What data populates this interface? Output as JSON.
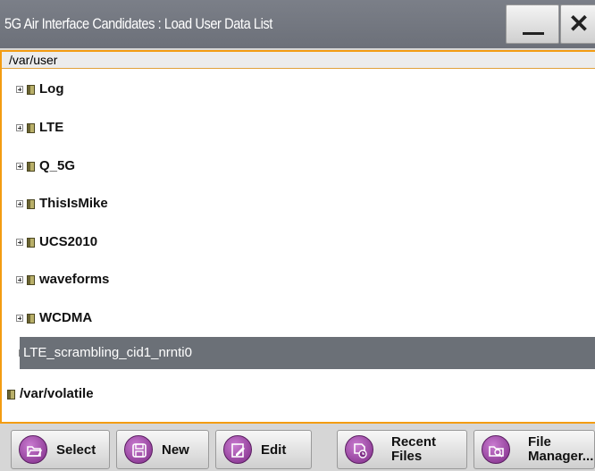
{
  "window": {
    "title": "5G Air Interface Candidates : Load User Data List",
    "minimize_label": "—",
    "close_label": "✕"
  },
  "tree": {
    "path": "/var/user",
    "folders": [
      {
        "label": "Log"
      },
      {
        "label": "LTE"
      },
      {
        "label": "Q_5G"
      },
      {
        "label": "ThisIsMike"
      },
      {
        "label": "UCS2010"
      },
      {
        "label": "waveforms"
      },
      {
        "label": "WCDMA"
      }
    ],
    "selected_file": "LTE_scrambling_cid1_nrnti0",
    "root_folder": "/var/volatile"
  },
  "toolbar": {
    "select": "Select",
    "new": "New",
    "edit": "Edit",
    "recent_line1": "Recent",
    "recent_line2": "Files",
    "file_line1": "File",
    "file_line2": "Manager..."
  }
}
